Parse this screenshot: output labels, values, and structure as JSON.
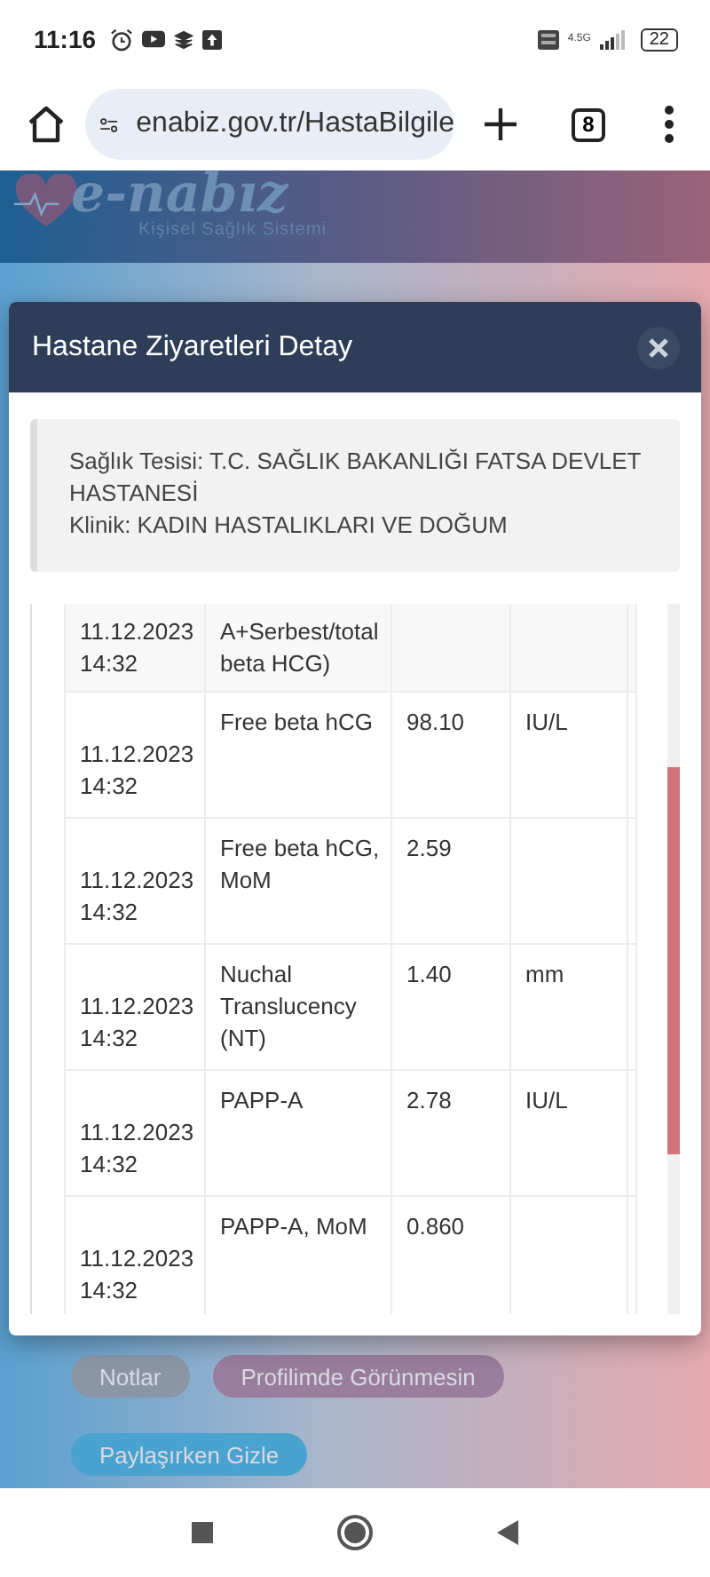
{
  "status_bar": {
    "time": "11:16",
    "network": "4.5G",
    "battery": "22"
  },
  "browser": {
    "url": "enabiz.gov.tr/HastaBilgile",
    "tab_count": "8"
  },
  "site_header": {
    "logo": "e-nabız",
    "tagline": "Kişisel Sağlık Sistemi"
  },
  "modal": {
    "title": "Hastane Ziyaretleri Detay",
    "info": [
      "Sağlık Tesisi: T.C. SAĞLIK BAKANLIĞI FATSA DEVLET HASTANESİ",
      "Klinik: KADIN HASTALIKLARI VE DOĞUM"
    ],
    "rows": [
      {
        "date": "11.12.2023 14:32",
        "test": "A+Serbest/total beta HCG)"
      },
      {
        "date": "11.12.2023 14:32",
        "test": "Free beta hCG",
        "result": "98.10",
        "unit": "IU/L"
      },
      {
        "date": "11.12.2023 14:32",
        "test": "Free beta hCG, MoM",
        "result": "2.59"
      },
      {
        "date": "11.12.2023 14:32",
        "test": "Nuchal Translucency (NT)",
        "result": "1.40",
        "unit": "mm"
      },
      {
        "date": "11.12.2023 14:32",
        "test": "PAPP-A",
        "result": "2.78",
        "unit": "IU/L"
      },
      {
        "date": "11.12.2023 14:32",
        "test": "PAPP-A, MoM",
        "result": "0.860"
      }
    ]
  },
  "page_buttons": [
    {
      "label": "Notlar",
      "color": "#8a96a6"
    },
    {
      "label": "Profilimde Görünmesin",
      "color": "#9a7c9c"
    },
    {
      "label": "Paylaşırken Gizle",
      "color": "#4aa2cf"
    }
  ]
}
